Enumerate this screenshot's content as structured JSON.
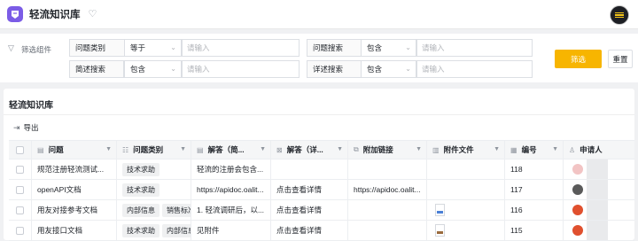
{
  "app": {
    "title": "轻流知识库"
  },
  "filter": {
    "group_label": "筛选组件",
    "rows": [
      {
        "field": "问题类别",
        "op": "等于",
        "placeholder": "请输入"
      },
      {
        "field": "问题搜索",
        "op": "包含",
        "placeholder": "请输入"
      },
      {
        "field": "简述搜索",
        "op": "包含",
        "placeholder": "请输入"
      },
      {
        "field": "详述搜索",
        "op": "包含",
        "placeholder": "请输入"
      }
    ],
    "filter_button": "筛选",
    "reset_button": "重置"
  },
  "panel": {
    "title": "轻流知识库",
    "export_label": "导出"
  },
  "table": {
    "columns": [
      "问题",
      "问题类别",
      "解答（简...",
      "解答（详...",
      "附加链接",
      "附件文件",
      "编号",
      "申请人"
    ],
    "rows": [
      {
        "question": "规范注册轻流测试...",
        "tags": [
          "技术求助"
        ],
        "brief": "轻流的注册会包含...",
        "detail": "",
        "link": "",
        "has_file": false,
        "file_type": "",
        "number": "118",
        "avatar_color": "#f0c0c0"
      },
      {
        "question": "openAPI文档",
        "tags": [
          "技术求助"
        ],
        "brief": "https://apidoc.oalit...",
        "detail": "点击查看详情",
        "link": "https://apidoc.oalit...",
        "has_file": false,
        "file_type": "",
        "number": "117",
        "avatar_color": "#5a5a5a"
      },
      {
        "question": "用友对接参考文档",
        "tags": [
          "内部信息",
          "销售标准"
        ],
        "brief": "1. 轻流调研后，以...",
        "detail": "点击查看详情",
        "link": "",
        "has_file": true,
        "file_type": "blue",
        "number": "116",
        "avatar_color": "#e0502e"
      },
      {
        "question": "用友接口文档",
        "tags": [
          "技术求助",
          "内部信息"
        ],
        "brief": "见附件",
        "detail": "点击查看详情",
        "link": "",
        "has_file": true,
        "file_type": "brown",
        "number": "115",
        "avatar_color": "#e0502e"
      }
    ]
  },
  "colors": {
    "accent": "#f7b500",
    "brand": "#7b5ce6"
  }
}
